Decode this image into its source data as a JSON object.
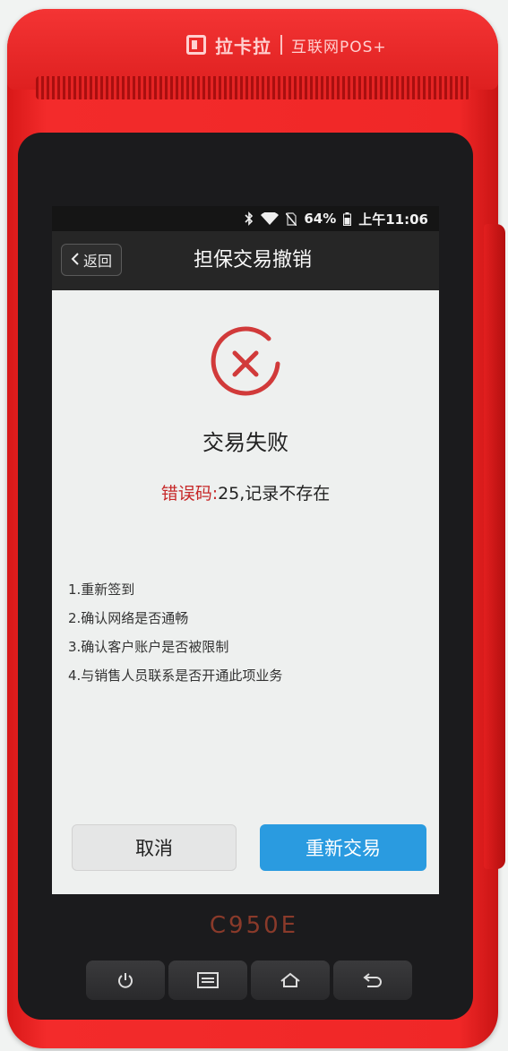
{
  "device": {
    "brand_name": "拉卡拉",
    "brand_tagline": "互联网POS+",
    "model": "C950E"
  },
  "status_bar": {
    "battery": "64%",
    "time": "上午11:06"
  },
  "header": {
    "back_label": "返回",
    "title": "担保交易撤销"
  },
  "result": {
    "icon": "fail-circle-x-icon",
    "title": "交易失败",
    "error_label": "错误码:",
    "error_value": "25,记录不存在"
  },
  "tips": [
    "1.重新签到",
    "2.确认网络是否通畅",
    "3.确认客户账户是否被限制",
    "4.与销售人员联系是否开通此项业务"
  ],
  "actions": {
    "cancel_label": "取消",
    "retry_label": "重新交易"
  },
  "nav_keys": [
    "power-icon",
    "menu-icon",
    "home-icon",
    "back-icon"
  ],
  "colors": {
    "device_red": "#f02727",
    "error_red": "#c62828",
    "primary_blue": "#2a9be0"
  }
}
